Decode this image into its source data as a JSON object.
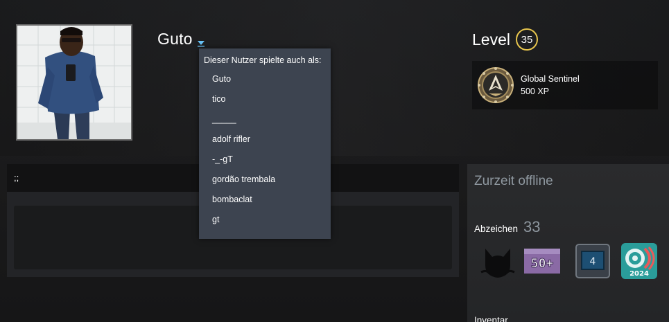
{
  "profile": {
    "persona_name": "Guto",
    "alias_dropdown": {
      "title": "Dieser Nutzer spielte auch als:",
      "aliases": [
        "Guto",
        "tico",
        "_____",
        "adolf rifler",
        "-_-gT",
        "gordão trembala",
        "bombaclat",
        "gt"
      ]
    }
  },
  "level": {
    "label": "Level",
    "value": "35",
    "badge_color": "#e8c64d"
  },
  "featured_badge": {
    "name": "Global Sentinel",
    "xp": "500 XP",
    "icon": "global-sentinel-badge-icon"
  },
  "summary": {
    "text": ";;"
  },
  "sidebar": {
    "status": "Zurzeit offline",
    "badges_label": "Abzeichen",
    "badges_count": "33",
    "badges": [
      {
        "icon": "black-cat-badge-icon"
      },
      {
        "icon": "fifty-plus-badge-icon",
        "text": "50+"
      },
      {
        "icon": "years-service-badge-icon",
        "text": "4"
      },
      {
        "icon": "steam-2024-badge-icon",
        "text": "2024"
      }
    ],
    "inventory_label": "Inventar"
  },
  "colors": {
    "dropdown_bg": "#3d4450",
    "muted_text": "#8f98a0",
    "page_bg": "#1b1b1c"
  }
}
